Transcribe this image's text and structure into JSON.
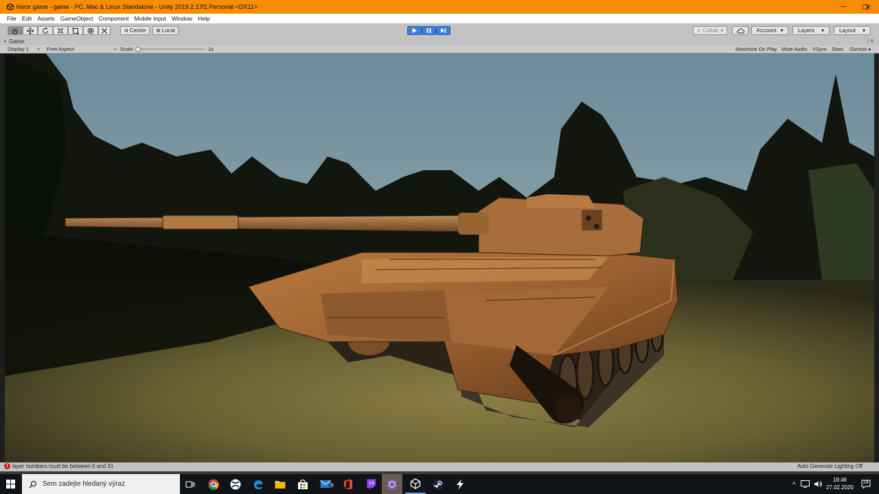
{
  "window": {
    "title": "horor game - game - PC, Mac & Linux Standalone - Unity 2019.2.17f1 Personal <DX11>",
    "minimize_glyph": "─",
    "maximize_glyph": "☐",
    "close_glyph": "✕"
  },
  "menu": [
    "File",
    "Edit",
    "Assets",
    "GameObject",
    "Component",
    "Mobile Input",
    "Window",
    "Help"
  ],
  "toolbar": {
    "tools": [
      "hand-tool-icon",
      "move-tool-icon",
      "rotate-tool-icon",
      "scale-tool-icon",
      "rect-tool-icon",
      "transform-tool-icon",
      "custom-tool-icon"
    ],
    "pivot_mode": "Center",
    "pivot_rotation": "Local",
    "collab": "Collab",
    "account": "Account",
    "layers": "Layers",
    "layout": "Layout"
  },
  "game_tab": {
    "label": "Game",
    "display": "Display 1",
    "aspect": "Free Aspect",
    "scale_label": "Scale",
    "scale_value": "1x",
    "maximize_on_play": "Maximize On Play",
    "mute_audio": "Mute Audio",
    "vsync": "VSync",
    "stats": "Stats",
    "gizmos": "Gizmos"
  },
  "status": {
    "error": "layer numbers must be between 0 and 31",
    "lighting": "Auto Generate Lighting Off"
  },
  "taskbar": {
    "search_placeholder": "Sem zadejte hledaný výraz",
    "time": "19:46",
    "date": "27.02.2020",
    "notifications": "24",
    "mail_badge": "3"
  },
  "colors": {
    "title_bar": "#f88c05",
    "play_button": "#3c7ed8"
  }
}
